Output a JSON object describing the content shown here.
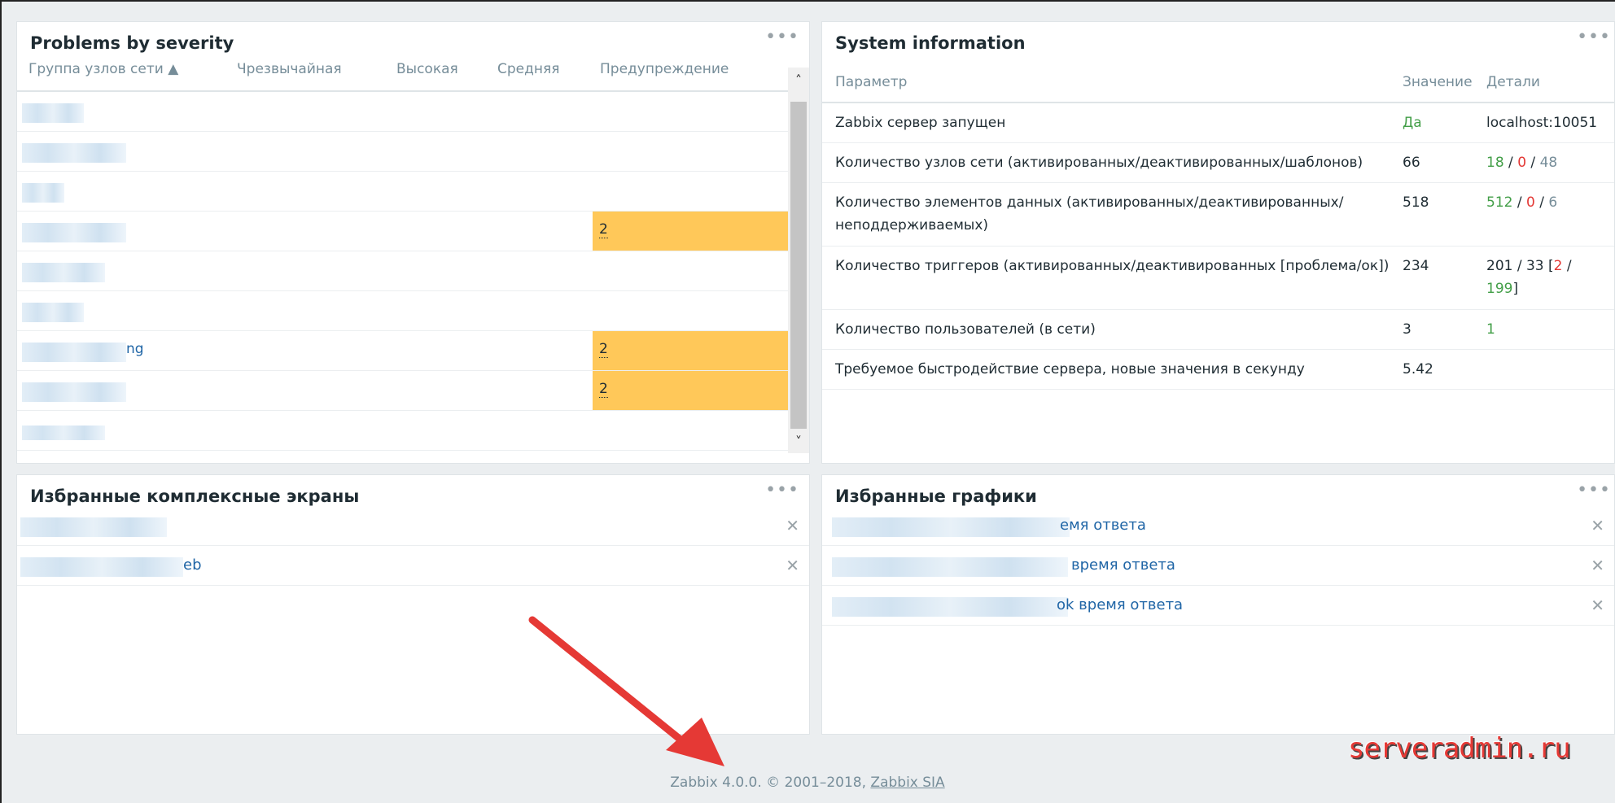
{
  "problems_widget": {
    "title": "Problems by severity",
    "menu": "•••",
    "columns": [
      "Группа узлов сети ▲",
      "Чрезвычайная",
      "Высокая",
      "Средняя",
      "Предупреждение"
    ],
    "rows": [
      {
        "name": "",
        "warning": ""
      },
      {
        "name": "",
        "warning": ""
      },
      {
        "name": "",
        "warning": ""
      },
      {
        "name": "",
        "warning": "2"
      },
      {
        "name": "",
        "warning": ""
      },
      {
        "name": "",
        "warning": ""
      },
      {
        "name": "ng",
        "warning": "2"
      },
      {
        "name": "",
        "warning": "2"
      },
      {
        "name": "",
        "warning": ""
      }
    ],
    "scroll_up": "˄",
    "scroll_down": "˅"
  },
  "system_info": {
    "title": "System information",
    "menu": "•••",
    "columns": [
      "Параметр",
      "Значение",
      "Детали"
    ],
    "rows": [
      {
        "param": "Zabbix сервер запущен",
        "value": "Да",
        "details": "localhost:10051"
      },
      {
        "param": "Количество узлов сети (активированных/деактивированных/шаблонов)",
        "value": "66",
        "d1": "18",
        "d2": "0",
        "d3": "48"
      },
      {
        "param": "Количество элементов данных (активированных/деактивированных/неподдерживаемых)",
        "value": "518",
        "d1": "512",
        "d2": "0",
        "d3": "6"
      },
      {
        "param": "Количество триггеров (активированных/деактивированных [проблема/ок])",
        "value": "234",
        "t1": "201 / 33 [",
        "t2": "2",
        "t3": " /",
        "t4": "199",
        "t5": "]"
      },
      {
        "param": "Количество пользователей (в сети)",
        "value": "3",
        "details": "1"
      },
      {
        "param": "Требуемое быстродействие сервера, новые значения в секунду",
        "value": "5.42",
        "details": ""
      }
    ],
    "sep": "/"
  },
  "fav_screens": {
    "title": "Избранные комплексные экраны",
    "menu": "•••",
    "items": [
      "",
      "eb"
    ],
    "close": "✕"
  },
  "fav_graphs": {
    "title": "Избранные графики",
    "menu": "•••",
    "items": [
      "емя ответа",
      "время ответа",
      "ok время ответа"
    ],
    "close": "✕"
  },
  "footer": {
    "text": "Zabbix 4.0.0. © 2001–2018, ",
    "link": "Zabbix SIA"
  },
  "watermark": "serveradmin.ru",
  "colors": {
    "warning": "#ffc859",
    "link": "#1f65a6",
    "ok": "#429e47",
    "problem": "#e33734"
  }
}
